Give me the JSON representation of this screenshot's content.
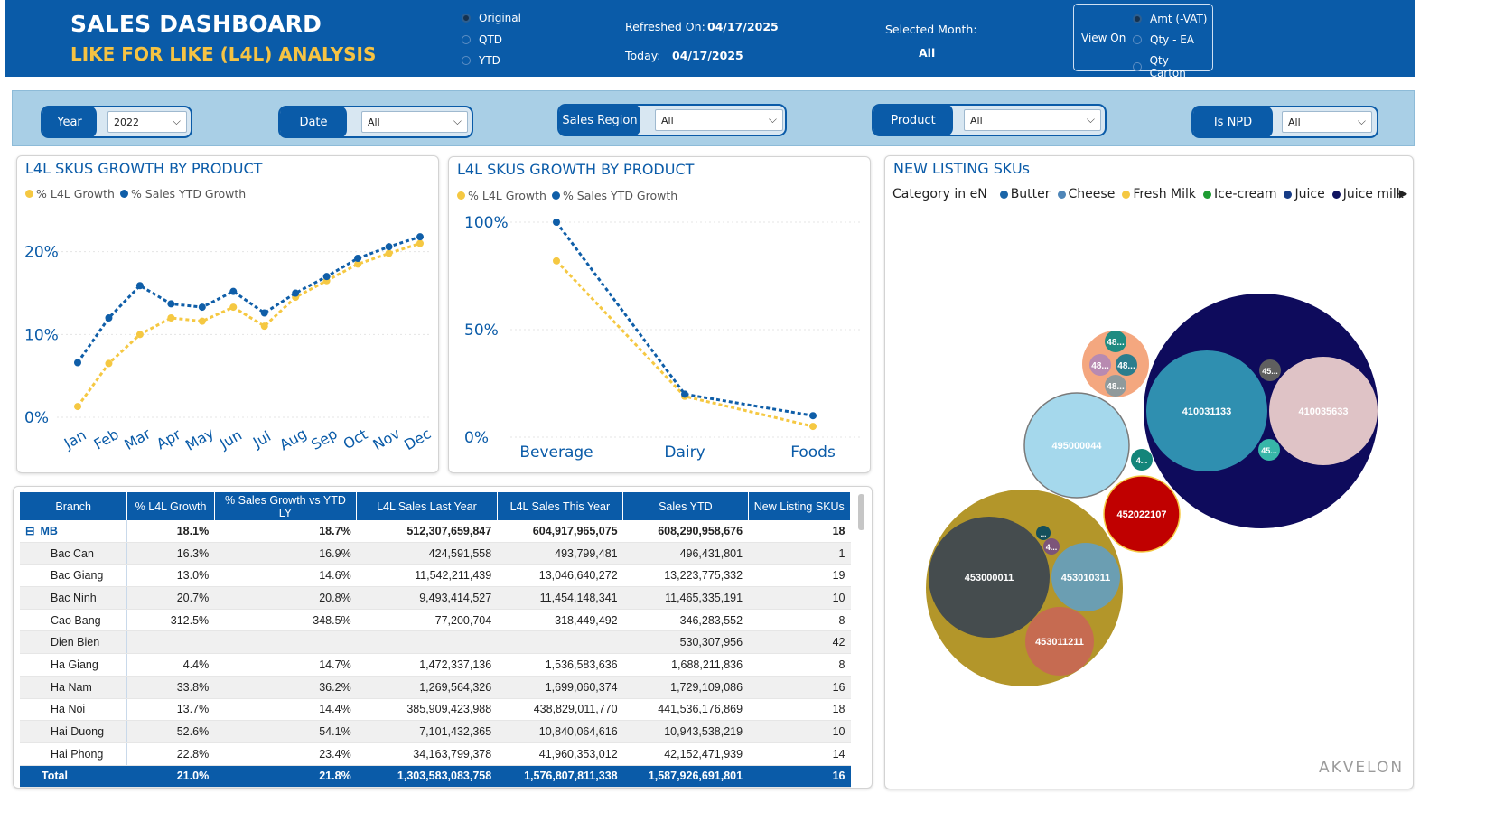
{
  "header": {
    "title": "SALES DASHBOARD",
    "subtitle": "LIKE FOR LIKE (L4L) ANALYSIS",
    "period_options": [
      "Original",
      "QTD",
      "YTD"
    ],
    "period_selected": "Original",
    "refreshed_label": "Refreshed On:",
    "refreshed_value": "04/17/2025",
    "today_label": "Today:",
    "today_value": "04/17/2025",
    "selected_month_label": "Selected Month:",
    "selected_month_value": "All",
    "view_on_label": "View On",
    "view_options": [
      "Amt (-VAT)",
      "Qty - EA",
      "Qty - Carton"
    ],
    "view_selected": "Amt (-VAT)"
  },
  "filters": {
    "year": {
      "label": "Year",
      "value": "2022"
    },
    "date": {
      "label": "Date",
      "value": "All"
    },
    "region": {
      "label": "Sales Region",
      "value": "All"
    },
    "product": {
      "label": "Product",
      "value": "All"
    },
    "npd": {
      "label": "Is NPD",
      "value": "All"
    }
  },
  "chart1": {
    "title": "L4L SKUS GROWTH BY PRODUCT"
  },
  "chart2": {
    "title": "L4L SKUS GROWTH BY PRODUCT"
  },
  "chart3": {
    "title": "NEW LISTING SKUs",
    "legend_title": "Category in eN"
  },
  "legend": {
    "series1": "% L4L Growth",
    "series2": "% Sales YTD Growth"
  },
  "colors": {
    "brand": "#0a5ba8",
    "accent": "#f6c343",
    "l4l": "#f5c842",
    "sales": "#0f5ea8"
  },
  "chart_data": [
    {
      "type": "line",
      "categories": [
        "Jan",
        "Feb",
        "Mar",
        "Apr",
        "May",
        "Jun",
        "Jul",
        "Aug",
        "Sep",
        "Oct",
        "Nov",
        "Dec"
      ],
      "yticks": [
        "0%",
        "10%",
        "20%"
      ],
      "ylim": [
        0,
        24
      ],
      "series": [
        {
          "name": "% L4L Growth",
          "values": [
            1.3,
            6.5,
            10.0,
            12.0,
            11.6,
            13.3,
            11.0,
            14.5,
            16.5,
            18.5,
            19.8,
            21.0
          ]
        },
        {
          "name": "% Sales YTD Growth",
          "values": [
            6.6,
            12.0,
            15.9,
            13.7,
            13.3,
            15.2,
            12.6,
            15.0,
            17.0,
            19.2,
            20.6,
            21.8
          ]
        }
      ]
    },
    {
      "type": "line",
      "categories": [
        "Beverage",
        "Dairy",
        "Foods"
      ],
      "yticks": [
        "0%",
        "50%",
        "100%"
      ],
      "ylim": [
        0,
        100
      ],
      "series": [
        {
          "name": "% L4L Growth",
          "values": [
            82,
            19,
            5
          ]
        },
        {
          "name": "% Sales YTD Growth",
          "values": [
            100,
            20,
            10
          ]
        }
      ]
    },
    {
      "type": "bubble",
      "legend": [
        "Butter",
        "Cheese",
        "Fresh Milk",
        "Ice-cream",
        "Juice",
        "Juice milk"
      ],
      "bubbles": [
        {
          "label": "410031133",
          "color": "#2f8fb0"
        },
        {
          "label": "410035633",
          "color": "#dfc3c6"
        },
        {
          "label": "45...",
          "color": "#5f5f5f"
        },
        {
          "label": "45...",
          "color": "#37b6a8"
        },
        {
          "label": "495000044",
          "color": "#a5d8ec"
        },
        {
          "label": "4...",
          "color": "#13857a"
        },
        {
          "label": "452022107",
          "color": "#c00000"
        },
        {
          "label": "453000011",
          "color": "#454c4e"
        },
        {
          "label": "453010311",
          "color": "#6b9eb2"
        },
        {
          "label": "453011211",
          "color": "#c66b51"
        },
        {
          "label": "...",
          "color": "#144f5b"
        },
        {
          "label": "4...",
          "color": "#7c5479"
        },
        {
          "label": "48...",
          "color": "#1f8c82"
        },
        {
          "label": "48...",
          "color": "#b88ab1"
        },
        {
          "label": "48...",
          "color": "#2b7d8d"
        },
        {
          "label": "48...",
          "color": "#8f9a9c"
        }
      ]
    }
  ],
  "table": {
    "columns": [
      "Branch",
      "% L4L Growth",
      "% Sales Growth vs YTD LY",
      "L4L Sales Last Year",
      "L4L Sales This Year",
      "Sales YTD",
      "New Listing SKUs"
    ],
    "group": {
      "expander": "⊟",
      "name": "MB",
      "values": [
        "18.1%",
        "18.7%",
        "512,307,659,847",
        "604,917,965,075",
        "608,290,958,676",
        "18"
      ]
    },
    "rows": [
      [
        "Bac Can",
        "16.3%",
        "16.9%",
        "424,591,558",
        "493,799,481",
        "496,431,801",
        "1"
      ],
      [
        "Bac Giang",
        "13.0%",
        "14.6%",
        "11,542,211,439",
        "13,046,640,272",
        "13,223,775,332",
        "19"
      ],
      [
        "Bac Ninh",
        "20.7%",
        "20.8%",
        "9,493,414,527",
        "11,454,148,341",
        "11,465,335,191",
        "10"
      ],
      [
        "Cao Bang",
        "312.5%",
        "348.5%",
        "77,200,704",
        "318,449,492",
        "346,283,552",
        "8"
      ],
      [
        "Dien Bien",
        "",
        "",
        "",
        "",
        "530,307,956",
        "42"
      ],
      [
        "Ha Giang",
        "4.4%",
        "14.7%",
        "1,472,337,136",
        "1,536,583,636",
        "1,688,211,836",
        "8"
      ],
      [
        "Ha Nam",
        "33.8%",
        "36.2%",
        "1,269,564,326",
        "1,699,060,374",
        "1,729,109,086",
        "16"
      ],
      [
        "Ha Noi",
        "13.7%",
        "14.4%",
        "385,909,423,988",
        "438,829,011,770",
        "441,536,176,869",
        "18"
      ],
      [
        "Hai Duong",
        "52.6%",
        "54.1%",
        "7,101,432,365",
        "10,840,064,616",
        "10,943,538,219",
        "10"
      ],
      [
        "Hai Phong",
        "22.8%",
        "23.4%",
        "34,163,799,378",
        "41,960,353,012",
        "42,152,471,939",
        "14"
      ]
    ],
    "total": [
      "Total",
      "21.0%",
      "21.8%",
      "1,303,583,083,758",
      "1,576,807,811,338",
      "1,587,926,691,801",
      "16"
    ]
  },
  "watermark": "AKVELON"
}
